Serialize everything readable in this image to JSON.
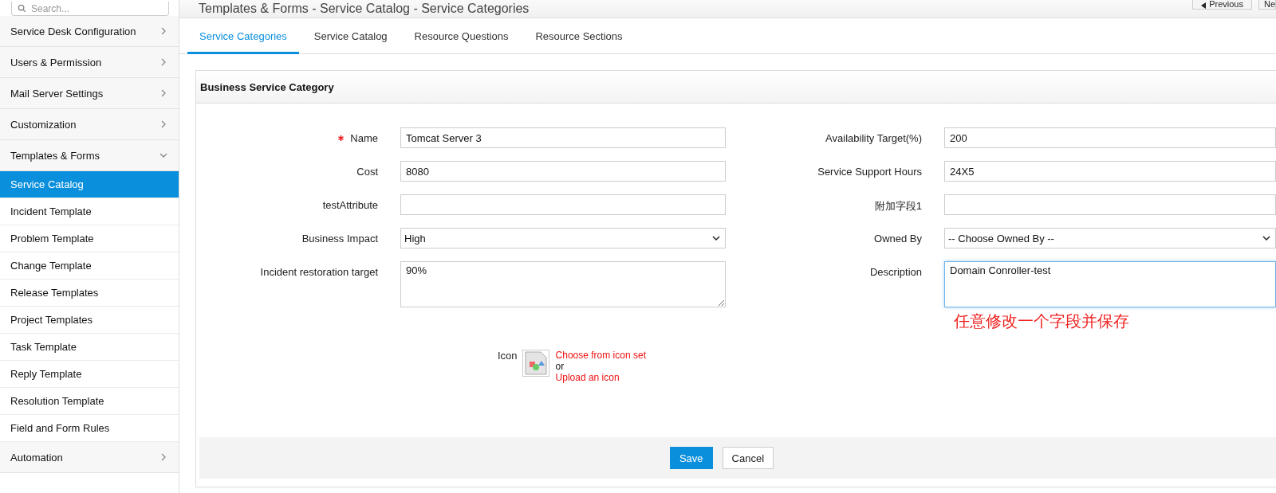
{
  "sidebar": {
    "search": {
      "placeholder": "Search..."
    },
    "items": [
      {
        "label": "Service Desk Configuration",
        "expanded": false
      },
      {
        "label": "Users & Permission",
        "expanded": false
      },
      {
        "label": "Mail Server Settings",
        "expanded": false
      },
      {
        "label": "Customization",
        "expanded": false
      },
      {
        "label": "Templates & Forms",
        "expanded": true,
        "children": [
          {
            "label": "Service Catalog",
            "selected": true
          },
          {
            "label": "Incident Template",
            "selected": false
          },
          {
            "label": "Problem Template",
            "selected": false
          },
          {
            "label": "Change Template",
            "selected": false
          },
          {
            "label": "Release Templates",
            "selected": false
          },
          {
            "label": "Project Templates",
            "selected": false
          },
          {
            "label": "Task Template",
            "selected": false
          },
          {
            "label": "Reply Template",
            "selected": false
          },
          {
            "label": "Resolution Template",
            "selected": false
          },
          {
            "label": "Field and Form Rules",
            "selected": false
          }
        ]
      },
      {
        "label": "Automation",
        "expanded": false
      }
    ]
  },
  "header": {
    "title": "Templates & Forms - Service Catalog - Service Categories",
    "buttons": [
      {
        "label": "Previous",
        "kind": "previous"
      },
      {
        "label": "Ne",
        "kind": "next"
      }
    ]
  },
  "tabs": [
    {
      "label": "Service Categories",
      "selected": true
    },
    {
      "label": "Service Catalog",
      "selected": false
    },
    {
      "label": "Resource Questions",
      "selected": false
    },
    {
      "label": "Resource Sections",
      "selected": false
    }
  ],
  "form": {
    "title": "Business Service Category",
    "left_fields": [
      {
        "label": "Name",
        "required": true,
        "kind": "text",
        "value": "Tomcat Server 3"
      },
      {
        "label": "Cost",
        "required": false,
        "kind": "text",
        "value": "8080"
      },
      {
        "label": "testAttribute",
        "required": false,
        "kind": "text"
      },
      {
        "label": "Business Impact",
        "required": false,
        "kind": "select",
        "value": "High"
      },
      {
        "label": "Incident restoration target",
        "required": false,
        "kind": "textarea",
        "value": "90%"
      }
    ],
    "right_fields": [
      {
        "label": "Availability Target(%)",
        "kind": "text",
        "value": "200",
        "focused": false
      },
      {
        "label": "Service Support Hours",
        "kind": "text",
        "value": "24X5",
        "focused": false
      },
      {
        "label": "附加字段1",
        "kind": "text",
        "focused": false
      },
      {
        "label": "Owned By",
        "kind": "select",
        "value": "-- Choose Owned By --",
        "focused": false
      },
      {
        "label": "Description",
        "kind": "textarea",
        "value": "Domain Conroller-test",
        "focused": true
      }
    ],
    "annotation": "任意修改一个字段并保存",
    "icon": {
      "label": "Icon",
      "choose_link": "Choose from icon set",
      "or": "or",
      "upload_link": "Upload an icon"
    },
    "buttons": [
      {
        "label": "Save",
        "kind": "primary"
      },
      {
        "label": "Cancel",
        "kind": "secondary"
      }
    ]
  }
}
